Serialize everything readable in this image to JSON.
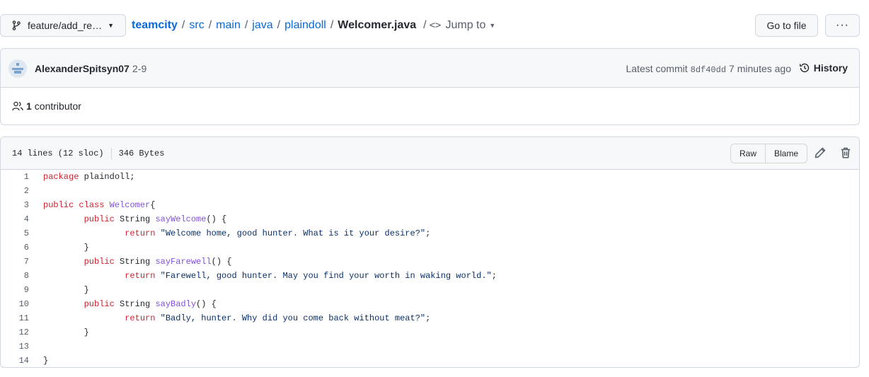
{
  "topbar": {
    "branch": "feature/add_re…",
    "breadcrumb": [
      "teamcity",
      "src",
      "main",
      "java",
      "plaindoll"
    ],
    "filename": "Welcomer.java",
    "jump_to": "Jump to",
    "go_to_file": "Go to file",
    "more": "···"
  },
  "commit": {
    "author": "AlexanderSpitsyn07",
    "message": "2-9",
    "latest_label": "Latest commit",
    "sha": "8df40dd",
    "time": "7 minutes ago",
    "history": "History",
    "contributors_count": "1",
    "contributors_label": "contributor"
  },
  "file": {
    "lines_info": "14 lines (12 sloc)",
    "size": "346 Bytes",
    "raw": "Raw",
    "blame": "Blame"
  },
  "code_lines": [
    {
      "n": "1",
      "tokens": [
        [
          "kw",
          "package"
        ],
        [
          "",
          " plaindoll;"
        ]
      ]
    },
    {
      "n": "2",
      "tokens": []
    },
    {
      "n": "3",
      "tokens": [
        [
          "kw",
          "public"
        ],
        [
          "",
          " "
        ],
        [
          "kw",
          "class"
        ],
        [
          "",
          " "
        ],
        [
          "ent",
          "Welcomer"
        ],
        [
          "",
          "{"
        ]
      ]
    },
    {
      "n": "4",
      "tokens": [
        [
          "",
          "        "
        ],
        [
          "kw",
          "public"
        ],
        [
          "",
          " String "
        ],
        [
          "ent",
          "sayWelcome"
        ],
        [
          "",
          "() {"
        ]
      ]
    },
    {
      "n": "5",
      "tokens": [
        [
          "",
          "                "
        ],
        [
          "kw",
          "return"
        ],
        [
          "",
          " "
        ],
        [
          "str",
          "\"Welcome home, good hunter. What is it your desire?\""
        ],
        [
          "",
          ";"
        ]
      ]
    },
    {
      "n": "6",
      "tokens": [
        [
          "",
          "        }"
        ]
      ]
    },
    {
      "n": "7",
      "tokens": [
        [
          "",
          "        "
        ],
        [
          "kw",
          "public"
        ],
        [
          "",
          " String "
        ],
        [
          "ent",
          "sayFarewell"
        ],
        [
          "",
          "() {"
        ]
      ]
    },
    {
      "n": "8",
      "tokens": [
        [
          "",
          "                "
        ],
        [
          "kw",
          "return"
        ],
        [
          "",
          " "
        ],
        [
          "str",
          "\"Farewell, good hunter. May you find your worth in waking world.\""
        ],
        [
          "",
          ";"
        ]
      ]
    },
    {
      "n": "9",
      "tokens": [
        [
          "",
          "        }"
        ]
      ]
    },
    {
      "n": "10",
      "tokens": [
        [
          "",
          "        "
        ],
        [
          "kw",
          "public"
        ],
        [
          "",
          " String "
        ],
        [
          "ent",
          "sayBadly"
        ],
        [
          "",
          "() {"
        ]
      ]
    },
    {
      "n": "11",
      "tokens": [
        [
          "",
          "                "
        ],
        [
          "kw",
          "return"
        ],
        [
          "",
          " "
        ],
        [
          "str",
          "\"Badly, hunter. Why did you come back without meat?\""
        ],
        [
          "",
          ";"
        ]
      ]
    },
    {
      "n": "12",
      "tokens": [
        [
          "",
          "        }"
        ]
      ]
    },
    {
      "n": "13",
      "tokens": []
    },
    {
      "n": "14",
      "tokens": [
        [
          "",
          "}"
        ]
      ]
    }
  ]
}
